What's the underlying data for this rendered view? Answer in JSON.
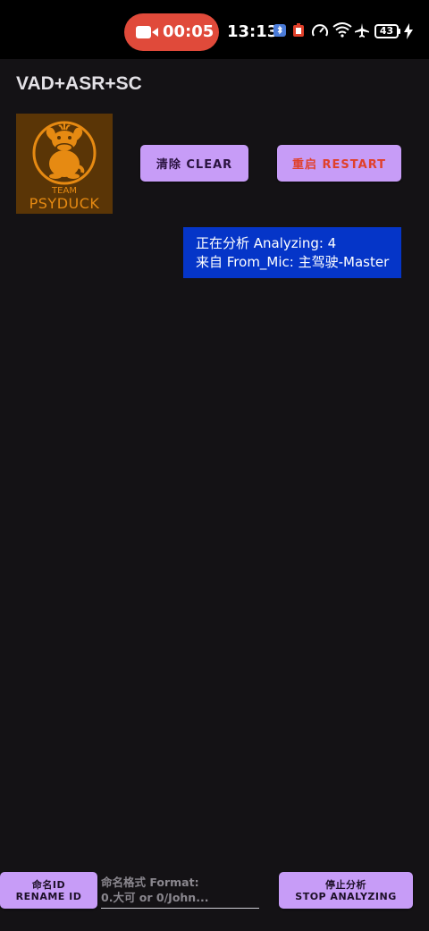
{
  "status_bar": {
    "recording_time": "00:05",
    "clock": "13:13",
    "battery_level": "43",
    "icons": [
      "video-camera-icon",
      "bluetooth-icon",
      "battery-saver-icon",
      "speedometer-icon",
      "wifi-icon",
      "airplane-icon",
      "charging-icon"
    ]
  },
  "app": {
    "title": "VAD+ASR+SC",
    "logo_text_top": "TEAM",
    "logo_text_bottom": "PSYDUCK"
  },
  "buttons": {
    "clear_label": "清除 CLEAR",
    "restart_label": "重启 RESTART"
  },
  "analyzing": {
    "line1": "正在分析 Analyzing: 4",
    "line2": "来自 From_Mic: 主驾驶-Master"
  },
  "bottom": {
    "rename_line1": "命名ID",
    "rename_line2": "RENAME ID",
    "input_placeholder_line1": "命名格式 Format:",
    "input_placeholder_line2": "0.大可 or 0/John...",
    "stop_line1": "停止分析",
    "stop_line2": "STOP ANALYZING"
  },
  "colors": {
    "background": "#141215",
    "button": "#c79cf7",
    "restart_text": "#e0402a",
    "panel": "#0535c8",
    "recording_pill": "#e04a3a",
    "logo_bg": "#5a3506",
    "logo_fg": "#e68a12"
  }
}
